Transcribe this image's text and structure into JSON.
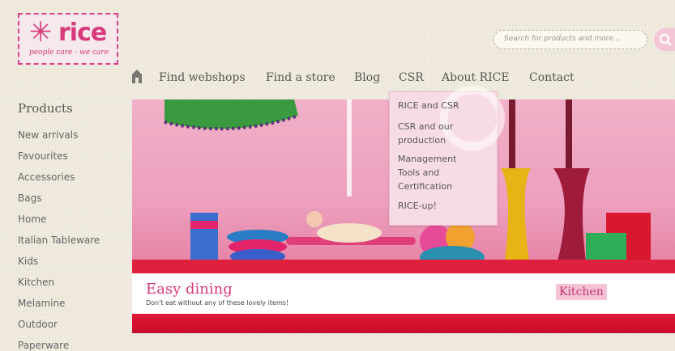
{
  "header": {
    "logo_text": "rice",
    "logo_tagline": "people care - we care",
    "search_placeholder": "Search for products and more..."
  },
  "nav": {
    "items": [
      {
        "label": "Find webshops"
      },
      {
        "label": "Find a store"
      },
      {
        "label": "Blog"
      },
      {
        "label": "CSR"
      },
      {
        "label": "About RICE"
      },
      {
        "label": "Contact"
      }
    ]
  },
  "csr_menu": {
    "items": [
      {
        "line1": "RICE and CSR",
        "line2": "",
        "line3": ""
      },
      {
        "line1": "CSR and our",
        "line2": "production",
        "line3": ""
      },
      {
        "line1": "Management",
        "line2": "Tools and",
        "line3": "Certification"
      },
      {
        "line1": "RICE-up!",
        "line2": "",
        "line3": ""
      }
    ]
  },
  "sidebar": {
    "title": "Products",
    "items": [
      {
        "label": "New arrivals"
      },
      {
        "label": "Favourites"
      },
      {
        "label": "Accessories"
      },
      {
        "label": "Bags"
      },
      {
        "label": "Home"
      },
      {
        "label": "Italian Tableware"
      },
      {
        "label": "Kids"
      },
      {
        "label": "Kitchen"
      },
      {
        "label": "Melamine"
      },
      {
        "label": "Outdoor"
      },
      {
        "label": "Paperware"
      }
    ]
  },
  "banner": {
    "title": "Easy dining",
    "subtitle": "Don't eat without any of these lovely items!",
    "tag": "Kitchen"
  },
  "colors": {
    "brand_pink": "#d83a7c",
    "table_red": "#e0203f",
    "dropdown_bg": "#f7dce6"
  }
}
